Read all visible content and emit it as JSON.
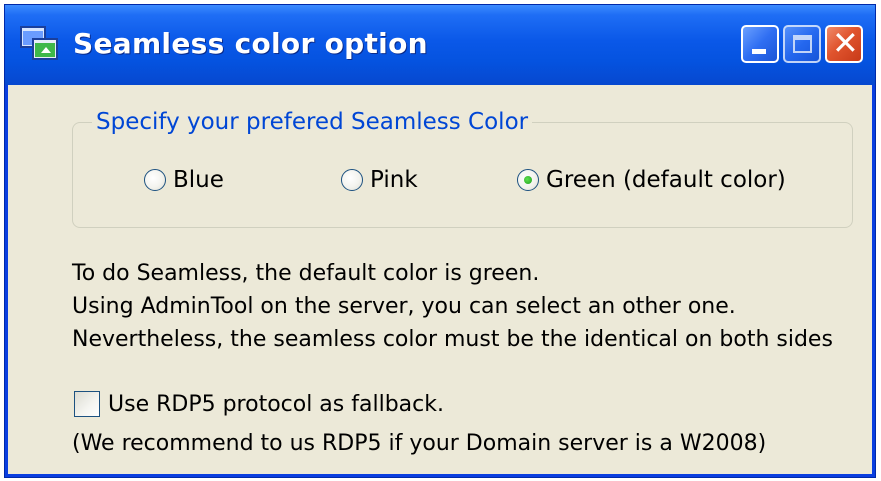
{
  "window": {
    "title": "Seamless color option",
    "icon": "app-window-icon",
    "colors": {
      "titlebar": "#0553e0",
      "client": "#ece9d8",
      "legend_text": "#0046d5",
      "close_button": "#e0542e"
    }
  },
  "group": {
    "legend": "Specify your prefered Seamless Color",
    "options": [
      {
        "label": "Blue",
        "checked": false
      },
      {
        "label": "Pink",
        "checked": false
      },
      {
        "label": "Green (default color)",
        "checked": true
      }
    ]
  },
  "info": {
    "line1": "To do Seamless, the default color is green.",
    "line2": "Using AdminTool on the server, you can select an other one.",
    "line3": "Nevertheless, the seamless color must be the identical on both sides"
  },
  "fallback": {
    "label": "Use RDP5 protocol as fallback.",
    "checked": false,
    "note": "(We recommend to us RDP5 if your Domain server is a W2008)"
  }
}
